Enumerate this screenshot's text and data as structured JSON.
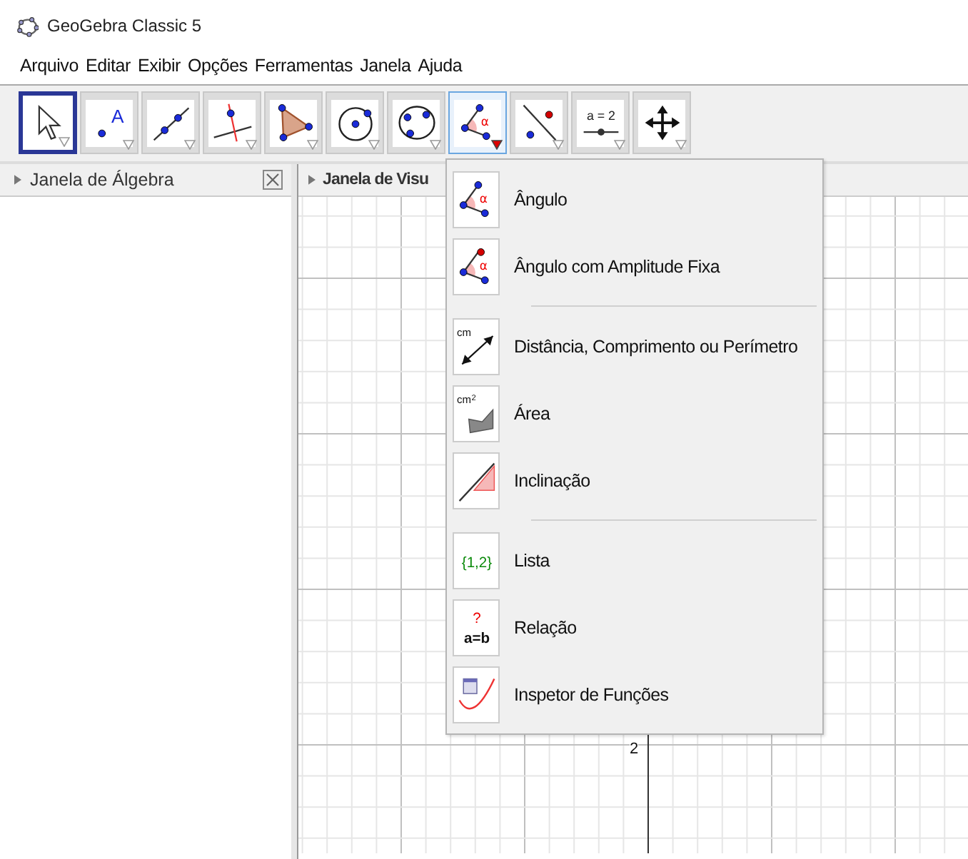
{
  "window": {
    "title": "GeoGebra Classic 5"
  },
  "menu_bar": [
    "Arquivo",
    "Editar",
    "Exibir",
    "Opções",
    "Ferramentas",
    "Janela",
    "Ajuda"
  ],
  "toolbar": [
    {
      "selected": true,
      "expanded": false
    },
    {
      "selected": false,
      "expanded": false,
      "icon_text": [
        "A"
      ]
    },
    {
      "selected": false,
      "expanded": false
    },
    {
      "selected": false,
      "expanded": false
    },
    {
      "selected": false,
      "expanded": false
    },
    {
      "selected": false,
      "expanded": false
    },
    {
      "selected": false,
      "expanded": false
    },
    {
      "selected": false,
      "expanded": true,
      "icon_text": [
        "α"
      ]
    },
    {
      "selected": false,
      "expanded": false
    },
    {
      "selected": false,
      "expanded": false,
      "icon_text": [
        "a = 2"
      ]
    },
    {
      "selected": false,
      "expanded": false
    }
  ],
  "algebra_panel": {
    "title": "Janela de Álgebra"
  },
  "graphics_panel": {
    "title": "Janela de Visu",
    "axis_label": "2"
  },
  "tool_menu": [
    [
      {
        "label": "Ângulo",
        "icon_text": [
          "α"
        ]
      },
      {
        "label": "Ângulo com Amplitude Fixa",
        "icon_text": [
          "α"
        ]
      }
    ],
    [
      {
        "label": "Distância, Comprimento ou Perímetro",
        "icon_text": [
          "cm"
        ]
      },
      {
        "label": "Área",
        "icon_text": [
          "cm",
          "2"
        ]
      },
      {
        "label": "Inclinação"
      }
    ],
    [
      {
        "label": "Lista",
        "icon_text": [
          "{1,2}"
        ]
      },
      {
        "label": "Relação",
        "icon_text": [
          "?",
          "a=b"
        ]
      },
      {
        "label": "Inspetor de Funções"
      }
    ]
  ]
}
